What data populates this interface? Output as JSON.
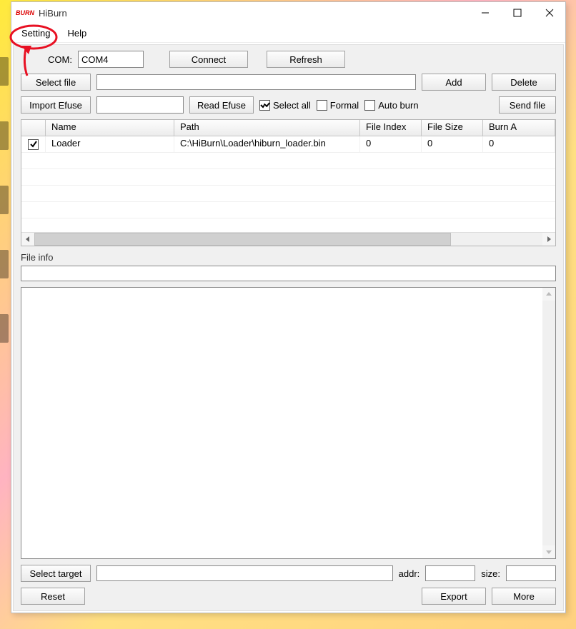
{
  "window": {
    "title": "HiBurn",
    "logo_text": "BURN"
  },
  "menu": {
    "setting": "Setting",
    "help": "Help"
  },
  "com": {
    "label": "COM:",
    "selected": "COM4",
    "connect": "Connect",
    "refresh": "Refresh"
  },
  "file_row": {
    "select_file": "Select file",
    "path": "",
    "add": "Add",
    "delete": "Delete"
  },
  "efuse_row": {
    "import_efuse": "Import Efuse",
    "value": "",
    "read_efuse": "Read Efuse",
    "select_all": "Select all",
    "select_all_checked": true,
    "formal": "Formal",
    "formal_checked": false,
    "auto_burn": "Auto burn",
    "auto_burn_checked": false,
    "send_file": "Send file"
  },
  "table": {
    "headers": {
      "check": "",
      "name": "Name",
      "path": "Path",
      "file_index": "File Index",
      "file_size": "File Size",
      "burn_addr": "Burn A"
    },
    "rows": [
      {
        "checked": true,
        "name": "Loader",
        "path": "C:\\HiBurn\\Loader\\hiburn_loader.bin",
        "file_index": "0",
        "file_size": "0",
        "burn_addr": "0"
      }
    ]
  },
  "file_info": {
    "label": "File info",
    "value": ""
  },
  "log": {
    "value": ""
  },
  "target_row": {
    "select_target": "Select target",
    "target_value": "",
    "addr_label": "addr:",
    "addr_value": "",
    "size_label": "size:",
    "size_value": ""
  },
  "footer": {
    "reset": "Reset",
    "export": "Export",
    "more": "More"
  }
}
